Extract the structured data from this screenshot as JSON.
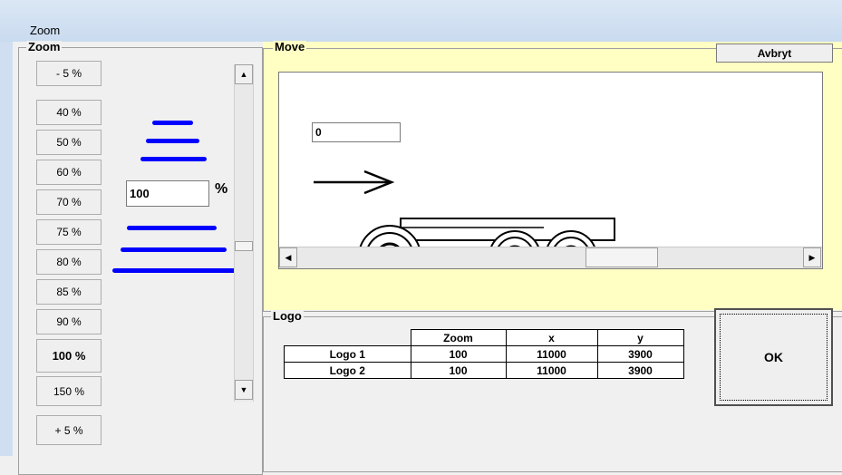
{
  "window": {
    "title": "Zoom"
  },
  "zoom_group": {
    "label": "Zoom",
    "minus_label": "- 5 %",
    "presets": [
      "40 %",
      "50 %",
      "60 %",
      "70 %",
      "75 %",
      "80 %",
      "85 %",
      "90 %",
      "100 %",
      "150 %"
    ],
    "plus_label": "+ 5 %",
    "percent_value": "100",
    "percent_sign": "%"
  },
  "move_group": {
    "label": "Move",
    "offset_value": "0",
    "arrow_icon": "right-arrow-icon",
    "vehicle_icon": "truck-trailer-icon"
  },
  "buttons": {
    "cancel": "Avbryt",
    "ok": "OK"
  },
  "logo_group": {
    "label": "Logo",
    "columns": [
      "Zoom",
      "x",
      "y"
    ],
    "rows": [
      {
        "name": "Logo 1",
        "zoom": "100",
        "x": "11000",
        "y": "3900"
      },
      {
        "name": "Logo 2",
        "zoom": "100",
        "x": "11000",
        "y": "3900"
      }
    ]
  },
  "colors": {
    "accent": "#0000ff",
    "move_background": "#ffffc4"
  }
}
